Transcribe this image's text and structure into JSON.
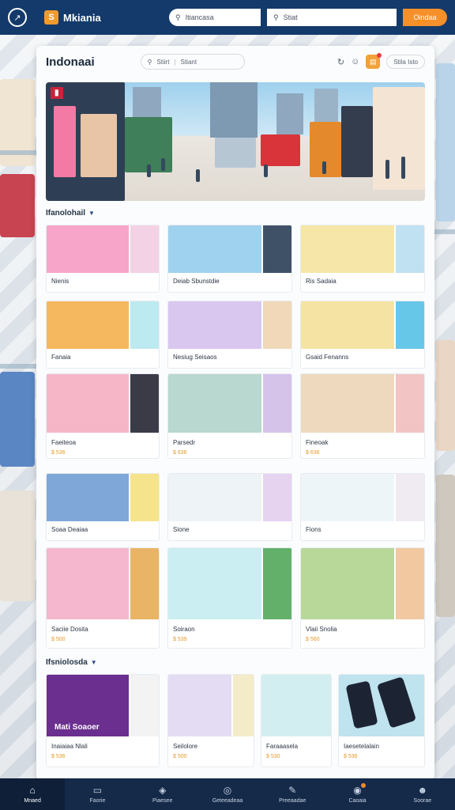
{
  "topbar": {
    "brand_name": "Mkiania",
    "brand_logo_letter": "S",
    "search_primary": "Itiancasa",
    "search_secondary": "Stiat",
    "cta_label": "Oindaa"
  },
  "panel": {
    "title": "Indonaai",
    "search_left": "Stiirt",
    "search_right": "Stiant",
    "pill_label": "Stila Isto"
  },
  "sections": [
    {
      "title": "Ifanolohail"
    },
    {
      "title": "Ifsniolosda"
    }
  ],
  "tiles": [
    {
      "label": "Nienis",
      "price": "",
      "colors": [
        "#f7a5c9",
        "#f3d2e6"
      ]
    },
    {
      "label": "Deiab Sbunstdie",
      "price": "",
      "colors": [
        "#9fd2ee",
        "#f3d6b4"
      ]
    },
    {
      "label": "Ris Sadaia",
      "price": "",
      "colors": [
        "#f6e6a7",
        "#bfe1f1"
      ]
    },
    {
      "label": "Fanaia",
      "price": "",
      "colors": [
        "#f6b85e",
        "#bde9f0"
      ]
    },
    {
      "label": "Nesiug Seisaos",
      "price": "",
      "colors": [
        "#d9c7f0",
        "#f0d8b8"
      ]
    },
    {
      "label": "Gsaid Fenanns",
      "price": "",
      "colors": [
        "#f4e3a2",
        "#66c7e8"
      ]
    },
    {
      "label": "Faeiteoa",
      "price": "$ 536",
      "colors": [
        "#f6b6c8",
        "#3b3b48"
      ]
    },
    {
      "label": "Parsedr",
      "price": "$ 636",
      "colors": [
        "#b9d8cf",
        "#d5c3ea"
      ]
    },
    {
      "label": "Fineoak",
      "price": "$ 636",
      "colors": [
        "#eed9be",
        "#f2c4c4"
      ]
    },
    {
      "label": "Soaa Deaiaa",
      "price": "",
      "colors": [
        "#7fa8d9",
        "#f6e48c"
      ]
    },
    {
      "label": "Sione",
      "price": "",
      "colors": [
        "#eef3f7",
        "#e6d3f0"
      ]
    },
    {
      "label": "Fions",
      "price": "",
      "colors": [
        "#eef5f8",
        "#f0eaf2"
      ]
    },
    {
      "label": "Saciie Dosita",
      "price": "$ 500",
      "colors": [
        "#f5b7cd",
        "#e9b466"
      ]
    },
    {
      "label": "Soiraon",
      "price": "$ 539",
      "colors": [
        "#cbeef2",
        "#62b06a"
      ]
    },
    {
      "label": "Vlaii Snolia",
      "price": "$ 560",
      "colors": [
        "#b8d89a",
        "#f2c8a0"
      ]
    },
    {
      "label": "Inaiaiaa Nlali",
      "price": "$ 536",
      "colors": [
        "#6b2f8f",
        "#f3f3f3"
      ]
    },
    {
      "label": "Seilolore",
      "price": "$ 500",
      "colors": [
        "#e3dcf3",
        "#f4ecc8"
      ]
    },
    {
      "label": "Faraaasela",
      "price": "$ 530",
      "colors": [
        "#d3eef0",
        "#f6e0b2"
      ]
    },
    {
      "label": "Iaesetelalain",
      "price": "$ 536",
      "colors": [
        "#bfe3ef",
        "#1c2433"
      ]
    }
  ],
  "featured_overlay": {
    "text": "Mati Soaoer"
  },
  "bottomnav": [
    {
      "label": "Mnaed",
      "icon": "home-icon"
    },
    {
      "label": "Faorie",
      "icon": "chat-icon"
    },
    {
      "label": "Piaesee",
      "icon": "tag-icon"
    },
    {
      "label": "Geteeadeaa",
      "icon": "compass-icon"
    },
    {
      "label": "Preeaadae",
      "icon": "edit-icon"
    },
    {
      "label": "Caoaia",
      "icon": "notification-icon"
    },
    {
      "label": "Soorae",
      "icon": "profile-icon"
    }
  ]
}
